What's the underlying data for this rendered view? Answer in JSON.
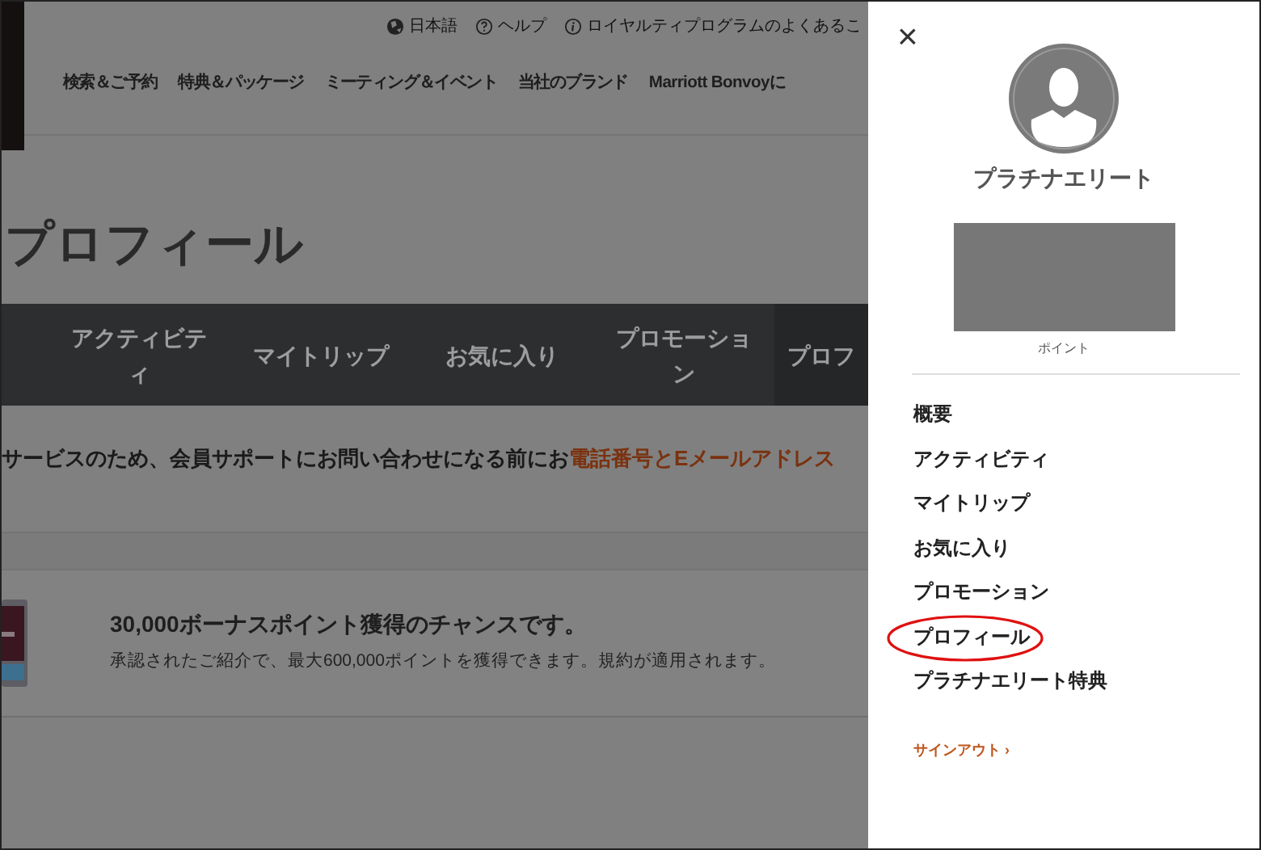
{
  "header_links": [
    {
      "kind": "globe",
      "label": "日本語"
    },
    {
      "kind": "help",
      "label": "ヘルプ"
    },
    {
      "kind": "info",
      "label": "ロイヤルティプログラムのよくあるこ"
    }
  ],
  "nav": [
    "検索＆ご予約",
    "特典＆パッケージ",
    "ミーティング＆イベント",
    "当社のブランド",
    "Marriott Bonvoyに"
  ],
  "page_title": "プロフィール",
  "tabs": [
    {
      "label": "アクティビティ",
      "selected": false
    },
    {
      "label": "マイトリップ",
      "selected": false
    },
    {
      "label": "お気に入り",
      "selected": false
    },
    {
      "label": "プロモーション",
      "selected": false
    },
    {
      "label": "プロフ",
      "selected": true
    }
  ],
  "notice": {
    "text": "サービスのため、会員サポートにお問い合わせになる前にお",
    "link": "電話番号とEメールアドレス"
  },
  "promo": {
    "title": "30,000ボーナスポイント獲得のチャンスです。",
    "body": "承認されたご紹介で、最大600,000ポイントを獲得できます。規約が適用されます。"
  },
  "panel": {
    "close": "×",
    "tier": "プラチナエリート",
    "points_label": "ポイント",
    "menu": [
      {
        "label": "概要",
        "circled": false
      },
      {
        "label": "アクティビティ",
        "circled": false
      },
      {
        "label": "マイトリップ",
        "circled": false
      },
      {
        "label": "お気に入り",
        "circled": false
      },
      {
        "label": "プロモーション",
        "circled": false
      },
      {
        "label": "プロフィール",
        "circled": true
      },
      {
        "label": "プラチナエリート特典",
        "circled": false
      }
    ],
    "sign_out": "サインアウト",
    "sign_out_arrow": "›"
  }
}
